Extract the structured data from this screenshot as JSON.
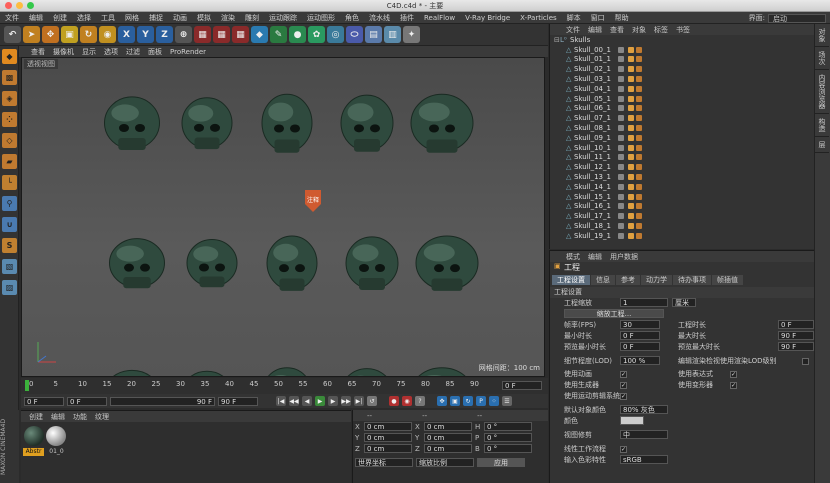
{
  "window": {
    "title": "C4D.c4d * - 主要"
  },
  "menubar": [
    "文件",
    "编辑",
    "创建",
    "选择",
    "工具",
    "网格",
    "捕捉",
    "动画",
    "模拟",
    "渲染",
    "雕刻",
    "运动跟踪",
    "运动图形",
    "角色",
    "流水线",
    "插件",
    "RealFlow",
    "V-Ray Bridge",
    "X-Particles",
    "脚本",
    "窗口",
    "帮助"
  ],
  "layout": {
    "label": "界面:",
    "value": "启动"
  },
  "toolbar": {
    "xyz": [
      "X",
      "Y",
      "Z"
    ]
  },
  "viewport": {
    "menu": [
      "查看",
      "摄像机",
      "显示",
      "选项",
      "过滤",
      "面板",
      "ProRender"
    ],
    "title": "透视视图",
    "annotation": "注释",
    "grid_info": "网格间距：100 cm"
  },
  "timeline": {
    "ticks": [
      "0",
      "5",
      "10",
      "15",
      "20",
      "25",
      "30",
      "35",
      "40",
      "45",
      "50",
      "55",
      "60",
      "65",
      "70",
      "75",
      "80",
      "85",
      "90"
    ],
    "end": "0 F"
  },
  "transport": {
    "start": "0 F",
    "current": "0 F",
    "end": "90 F",
    "end2": "90 F"
  },
  "material": {
    "menu": [
      "创建",
      "编辑",
      "功能",
      "纹理"
    ],
    "items": [
      "Abstr",
      "01_0"
    ]
  },
  "coords": {
    "headers": [
      "--",
      "--",
      "--"
    ],
    "rows": [
      [
        "X",
        "0 cm",
        "X",
        "0 cm",
        "H",
        "0 °"
      ],
      [
        "Y",
        "0 cm",
        "Y",
        "0 cm",
        "P",
        "0 °"
      ],
      [
        "Z",
        "0 cm",
        "Z",
        "0 cm",
        "B",
        "0 °"
      ]
    ],
    "world": "世界坐标",
    "scale": "缩放比例",
    "apply": "应用"
  },
  "objects": {
    "menu": [
      "文件",
      "编辑",
      "查看",
      "对象",
      "标签",
      "书签"
    ],
    "root": "Skulls",
    "items": [
      "Skull_00_1",
      "Skull_01_1",
      "Skull_02_1",
      "Skull_03_1",
      "Skull_04_1",
      "Skull_05_1",
      "Skull_06_1",
      "Skull_07_1",
      "Skull_08_1",
      "Skull_09_1",
      "Skull_10_1",
      "Skull_11_1",
      "Skull_12_1",
      "Skull_13_1",
      "Skull_14_1",
      "Skull_15_1",
      "Skull_16_1",
      "Skull_17_1",
      "Skull_18_1",
      "Skull_19_1"
    ]
  },
  "attributes": {
    "menu": [
      "模式",
      "编辑",
      "用户数据"
    ],
    "title": "工程",
    "tabs": [
      "工程设置",
      "信息",
      "参考",
      "动力学",
      "待办事项",
      "帧插值"
    ],
    "section": "工程设置",
    "scale_label": "工程缩放",
    "scale_value": "1",
    "scale_unit": "厘米",
    "scale_btn": "缩放工程...",
    "fps_label": "帧率(FPS)",
    "fps": "30",
    "time_label": "工程时长",
    "time": "0 F",
    "min_label": "最小时长",
    "min": "0 F",
    "max_label": "最大时长",
    "max": "90 F",
    "pmin_label": "预览最小时长",
    "pmin": "0 F",
    "pmax_label": "预览最大时长",
    "pmax": "90 F",
    "lod_label": "细节程度(LOD)",
    "lod": "100 %",
    "lod_note": "编辑渲染检视使用渲染LOD级别",
    "c1": "使用动画",
    "c2": "使用表达式",
    "c3": "使用生成器",
    "c4": "使用变形器",
    "c5": "使用运动剪辑系统",
    "color_label": "默认对象颜色",
    "color_value": "80% 灰色",
    "color2": "颜色",
    "clip_label": "视图修剪",
    "clip": "中",
    "linear": "线性工作流程",
    "input": "输入色彩特性",
    "input_value": "sRGB"
  },
  "side_tabs": [
    "对象",
    "场次",
    "内容浏览器",
    "构造",
    "层"
  ],
  "colors": {
    "accent": "#5a6a7a",
    "skull": "#2f4a3e"
  }
}
